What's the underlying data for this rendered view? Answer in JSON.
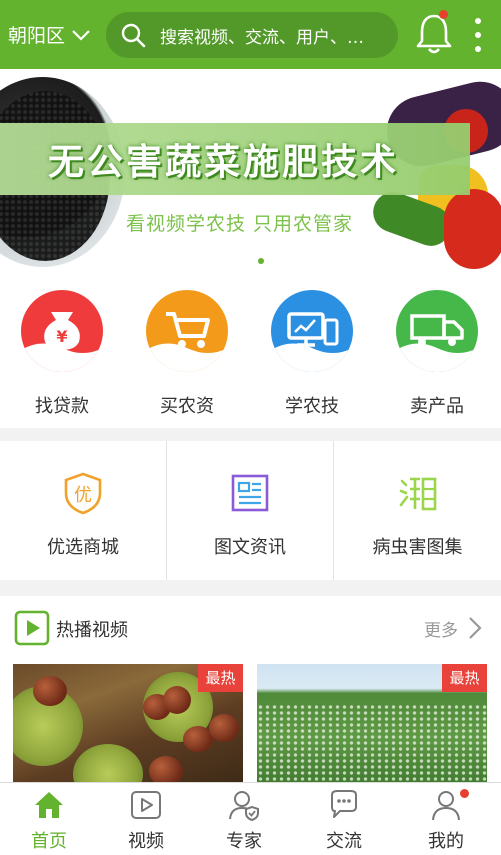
{
  "header": {
    "district": "朝阳区",
    "search_placeholder": "搜索视频、交流、用户、…",
    "accent_color": "#63b32e",
    "notification_dot": true
  },
  "banner": {
    "title": "无公害蔬菜施肥技术",
    "slogan": "看视频学农技  只用农管家",
    "page_count": 1,
    "current_page": 1
  },
  "services": [
    {
      "label": "找贷款",
      "icon": "money-bag-icon",
      "color": "#ef3b3b"
    },
    {
      "label": "买农资",
      "icon": "shopping-cart-icon",
      "color": "#f39a1a"
    },
    {
      "label": "学农技",
      "icon": "computer-icon",
      "color": "#2b8fe2"
    },
    {
      "label": "卖产品",
      "icon": "truck-icon",
      "color": "#46b84a"
    }
  ],
  "functions": [
    {
      "label": "优选商城",
      "icon": "shield-you-icon",
      "glyph": "优"
    },
    {
      "label": "图文资讯",
      "icon": "article-icon"
    },
    {
      "label": "病虫害图集",
      "icon": "pest-atlas-icon",
      "glyph": "⿰"
    }
  ],
  "videos": {
    "title": "热播视频",
    "more": "更多",
    "items": [
      {
        "badge": "最热"
      },
      {
        "badge": "最热"
      }
    ]
  },
  "tabbar": [
    {
      "label": "首页",
      "icon": "home-icon",
      "active": true
    },
    {
      "label": "视频",
      "icon": "video-icon",
      "active": false
    },
    {
      "label": "专家",
      "icon": "expert-icon",
      "active": false
    },
    {
      "label": "交流",
      "icon": "chat-icon",
      "active": false
    },
    {
      "label": "我的",
      "icon": "profile-icon",
      "active": false,
      "dot": true
    }
  ]
}
